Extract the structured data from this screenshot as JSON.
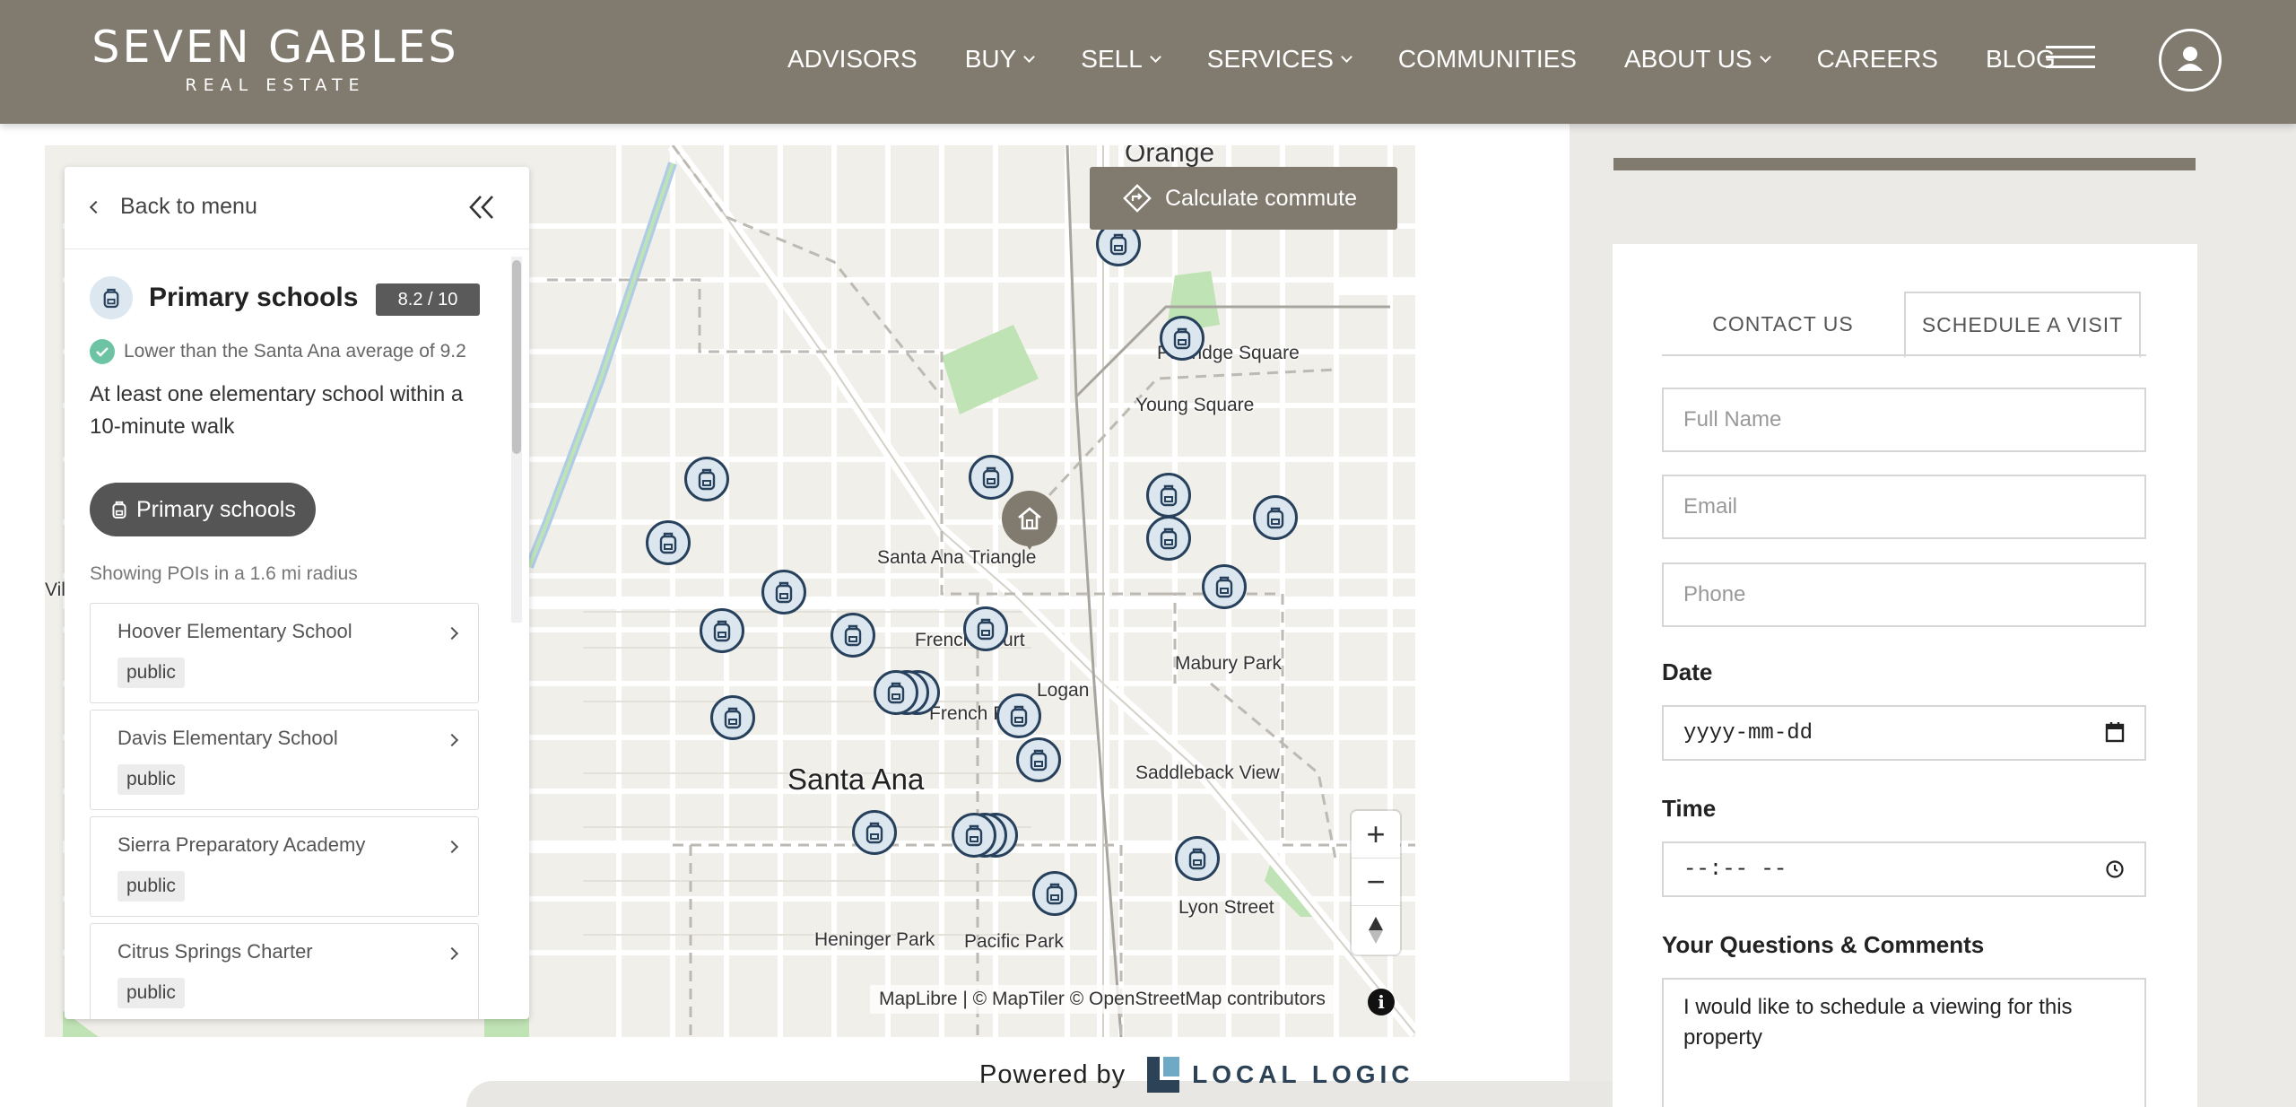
{
  "header": {
    "logo_main": "SEVEN GABLES",
    "logo_sub": "REAL ESTATE",
    "nav": [
      {
        "label": "ADVISORS"
      },
      {
        "label": "BUY"
      },
      {
        "label": "SELL"
      },
      {
        "label": "SERVICES"
      },
      {
        "label": "COMMUNITIES"
      },
      {
        "label": "ABOUT US"
      },
      {
        "label": "CAREERS"
      },
      {
        "label": "BLOG"
      }
    ]
  },
  "map": {
    "commute_label": "Calculate commute",
    "labels": {
      "orange": "Orange",
      "partridge": "Partridge Square",
      "young": "Young Square",
      "triangle": "Santa Ana Triangle",
      "french_court": "French Court",
      "logan": "Logan",
      "french_park": "French Park",
      "mabury": "Mabury Park",
      "santa_ana": "Santa Ana",
      "saddleback": "Saddleback View",
      "heninger": "Heninger Park",
      "pacific": "Pacific Park",
      "lyon": "Lyon Street",
      "villa": "Villa"
    },
    "attribution": "MapLibre | © MapTiler © OpenStreetMap contributors",
    "zoom_in": "+",
    "zoom_out": "−"
  },
  "panel": {
    "back_label": "Back to menu",
    "category": "Primary schools",
    "score": "8.2 / 10",
    "comparison": "Lower than the Santa Ana average of 9.2",
    "description": "At least one elementary school within a 10-minute walk",
    "filter_pill": "Primary schools",
    "radius_text": "Showing POIs in a 1.6 mi radius",
    "schools": [
      {
        "name": "Hoover Elementary School",
        "type": "public"
      },
      {
        "name": "Davis Elementary School",
        "type": "public"
      },
      {
        "name": "Sierra Preparatory Academy",
        "type": "public"
      },
      {
        "name": "Citrus Springs Charter",
        "type": "public"
      }
    ]
  },
  "powered_by": {
    "prefix": "Powered by",
    "brand": "LOCAL LOGIC"
  },
  "form": {
    "tabs": [
      "CONTACT US",
      "SCHEDULE A VISIT"
    ],
    "full_name_placeholder": "Full Name",
    "email_placeholder": "Email",
    "phone_placeholder": "Phone",
    "date_label": "Date",
    "date_value": "yyyy-mm-dd",
    "time_label": "Time",
    "time_value": "--:-- --",
    "comments_label": "Your Questions & Comments",
    "comments_value": "I would like to schedule a viewing for this property"
  },
  "colors": {
    "brand": "#817a6e",
    "poi_fill": "#dbe6ee",
    "poi_border": "#27415c",
    "score_badge": "#5a5a5a",
    "check": "#6cc4a5"
  }
}
